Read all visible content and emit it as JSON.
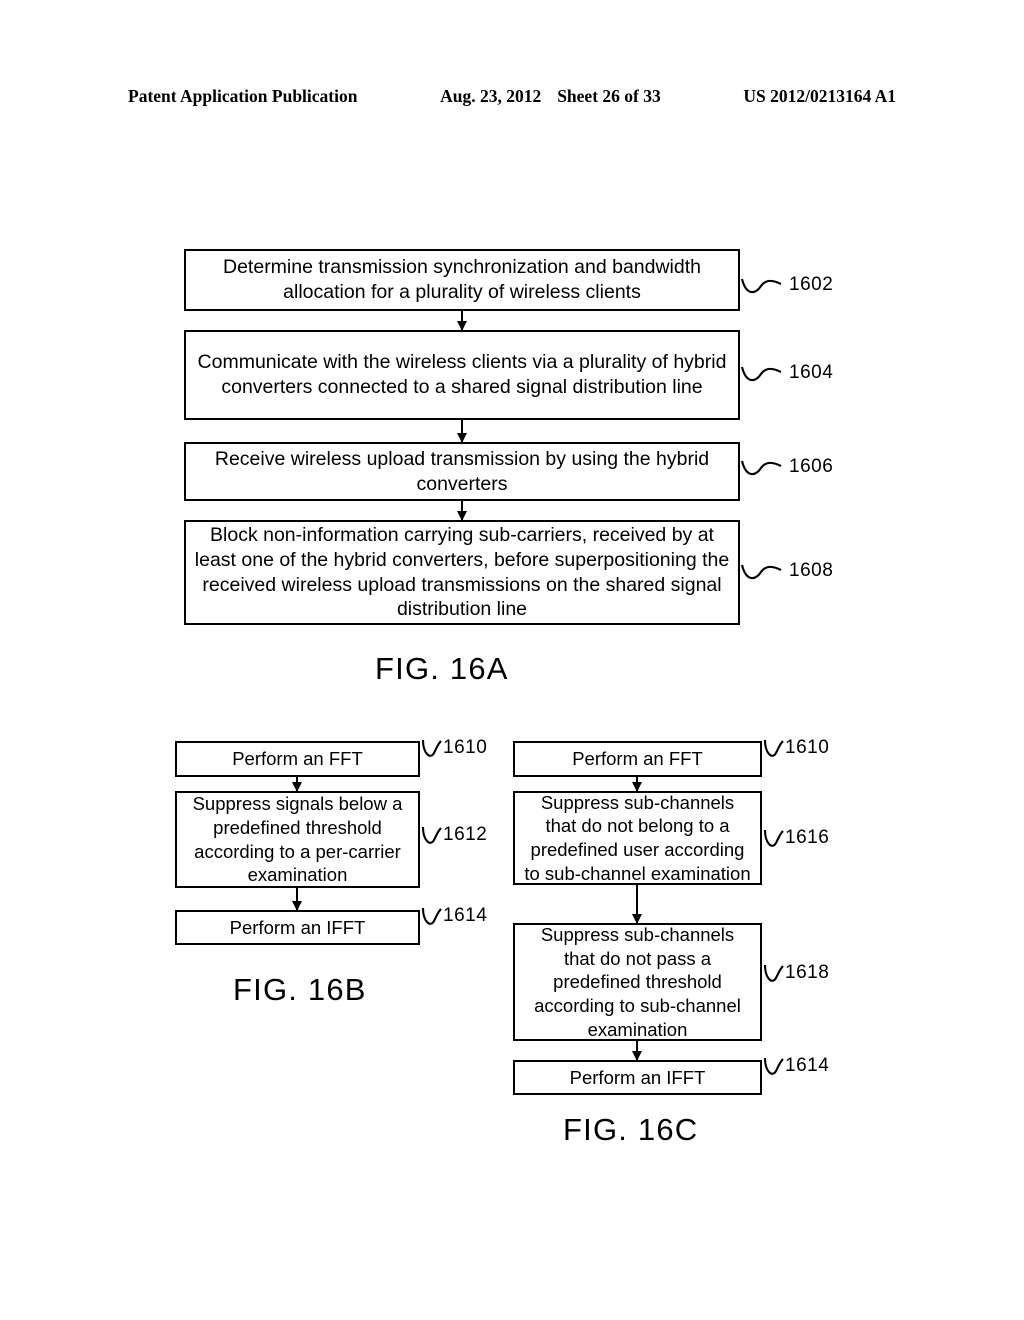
{
  "header": {
    "publication": "Patent Application Publication",
    "date": "Aug. 23, 2012",
    "sheet": "Sheet 26 of 33",
    "patent_number": "US 2012/0213164 A1"
  },
  "figures": [
    {
      "caption": "FIG. 16A",
      "steps": [
        {
          "ref": "1602",
          "text": "Determine transmission synchronization and bandwidth allocation for a plurality of wireless clients"
        },
        {
          "ref": "1604",
          "text": "Communicate with the wireless clients via a plurality of hybrid converters connected to a shared signal distribution line"
        },
        {
          "ref": "1606",
          "text": "Receive wireless upload transmission by using the hybrid converters"
        },
        {
          "ref": "1608",
          "text": "Block non-information carrying sub-carriers, received by at least one of the hybrid converters, before superpositioning the received wireless upload transmissions on the shared signal distribution line"
        }
      ]
    },
    {
      "caption": "FIG. 16B",
      "steps": [
        {
          "ref": "1610",
          "text": "Perform an FFT"
        },
        {
          "ref": "1612",
          "text": "Suppress signals below a predefined threshold according to a per-carrier examination"
        },
        {
          "ref": "1614",
          "text": "Perform an IFFT"
        }
      ]
    },
    {
      "caption": "FIG. 16C",
      "steps": [
        {
          "ref": "1610",
          "text": "Perform an FFT"
        },
        {
          "ref": "1616",
          "text": "Suppress sub-channels that do not belong to a predefined user according to sub-channel examination"
        },
        {
          "ref": "1618",
          "text": "Suppress sub-channels that do not pass a predefined threshold according to sub-channel examination"
        },
        {
          "ref": "1614",
          "text": "Perform an IFFT"
        }
      ]
    }
  ],
  "colors": {
    "ink": "#000000",
    "paper": "#ffffff"
  }
}
